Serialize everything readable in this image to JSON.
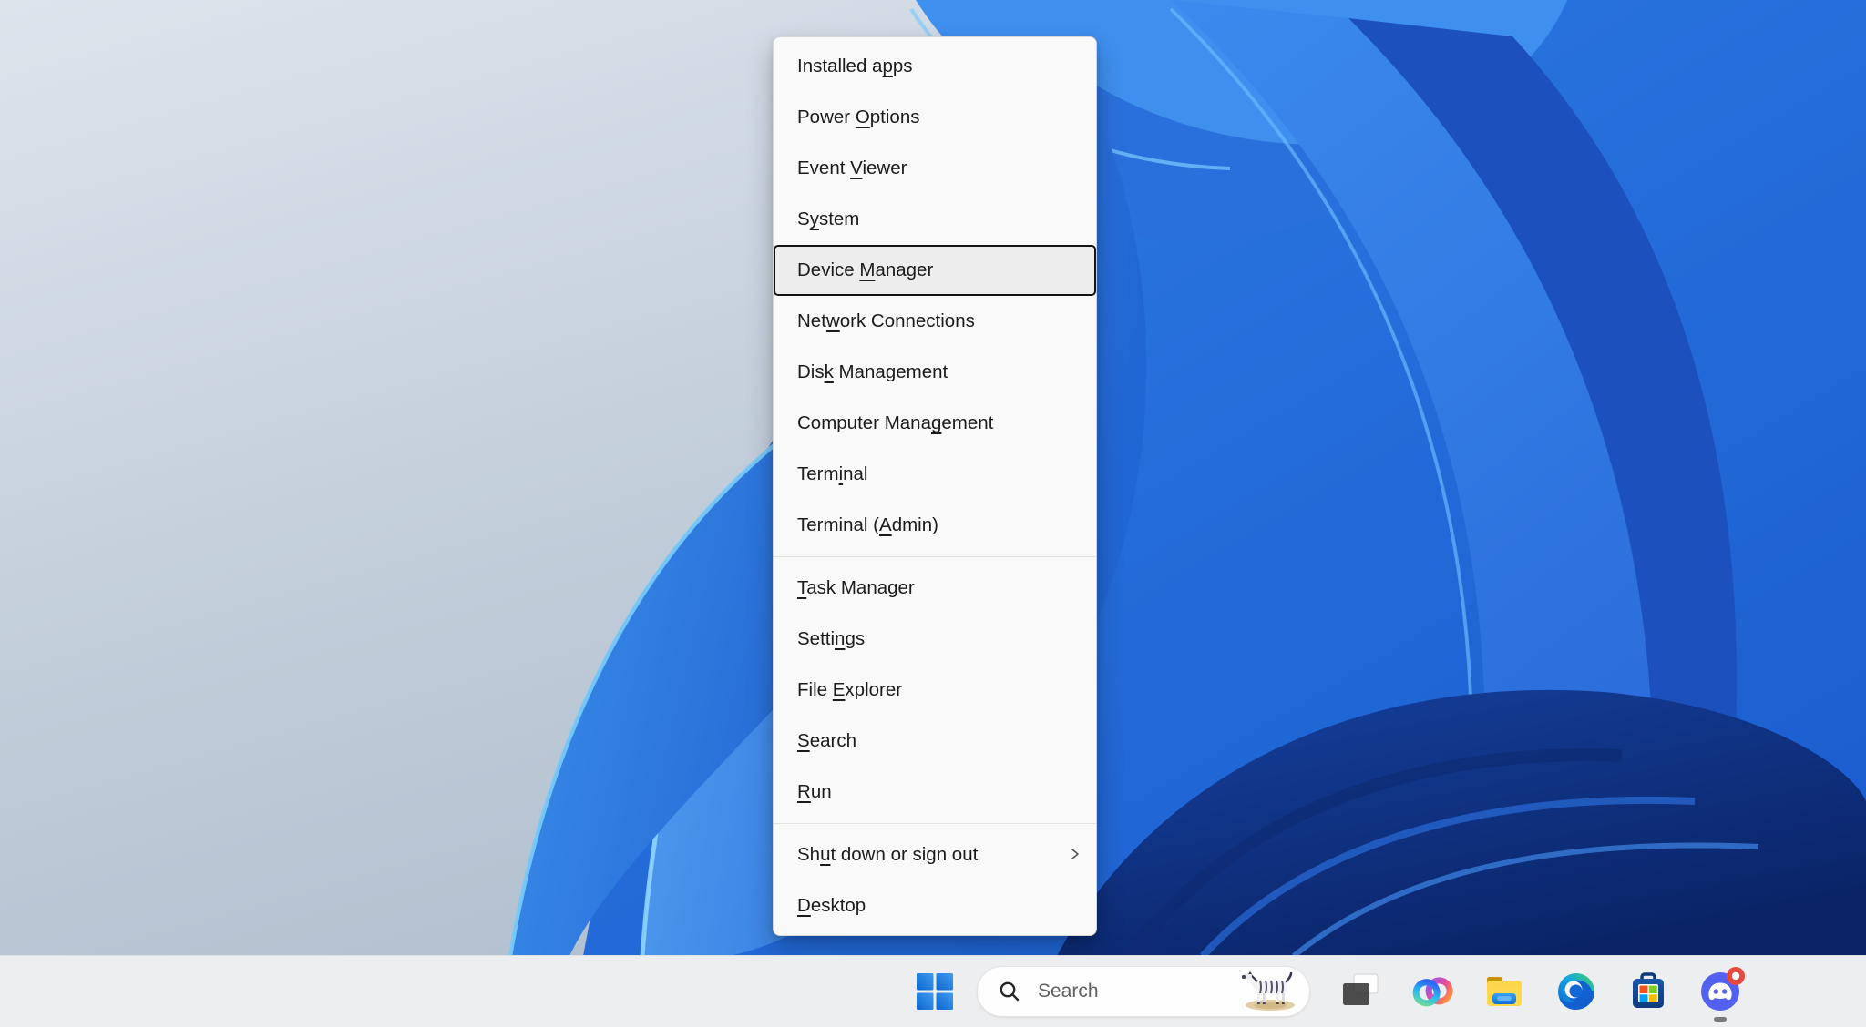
{
  "menu": {
    "items": [
      {
        "label": "Installed apps",
        "u": 11
      },
      {
        "label": "Power Options",
        "u": 6
      },
      {
        "label": "Event Viewer",
        "u": 6
      },
      {
        "label": "System",
        "u": 1
      },
      {
        "label": "Device Manager",
        "u": 7,
        "focused": true
      },
      {
        "label": "Network Connections",
        "u": 3
      },
      {
        "label": "Disk Management",
        "u": 3
      },
      {
        "label": "Computer Management",
        "u": 13
      },
      {
        "label": "Terminal",
        "u": 4
      },
      {
        "label": "Terminal (Admin)",
        "u": 10
      },
      {
        "separator": true
      },
      {
        "label": "Task Manager",
        "u": 0
      },
      {
        "label": "Settings",
        "u": 5
      },
      {
        "label": "File Explorer",
        "u": 5
      },
      {
        "label": "Search",
        "u": 0
      },
      {
        "label": "Run",
        "u": 0
      },
      {
        "separator": true
      },
      {
        "label": "Shut down or sign out",
        "u": 2,
        "submenu": true
      },
      {
        "label": "Desktop",
        "u": 0
      }
    ]
  },
  "taskbar": {
    "search_placeholder": "Search",
    "icons": [
      "start",
      "search",
      "task-view",
      "copilot",
      "file-explorer",
      "edge",
      "microsoft-store",
      "discord"
    ],
    "colors": {
      "start_blue": "#1873d3",
      "discord_blue": "#5261f0",
      "badge_red": "#e64940",
      "store_red": "#f1511b",
      "store_green": "#80cc28",
      "store_blue": "#00a1f1",
      "store_yellow": "#fbbc09"
    }
  }
}
